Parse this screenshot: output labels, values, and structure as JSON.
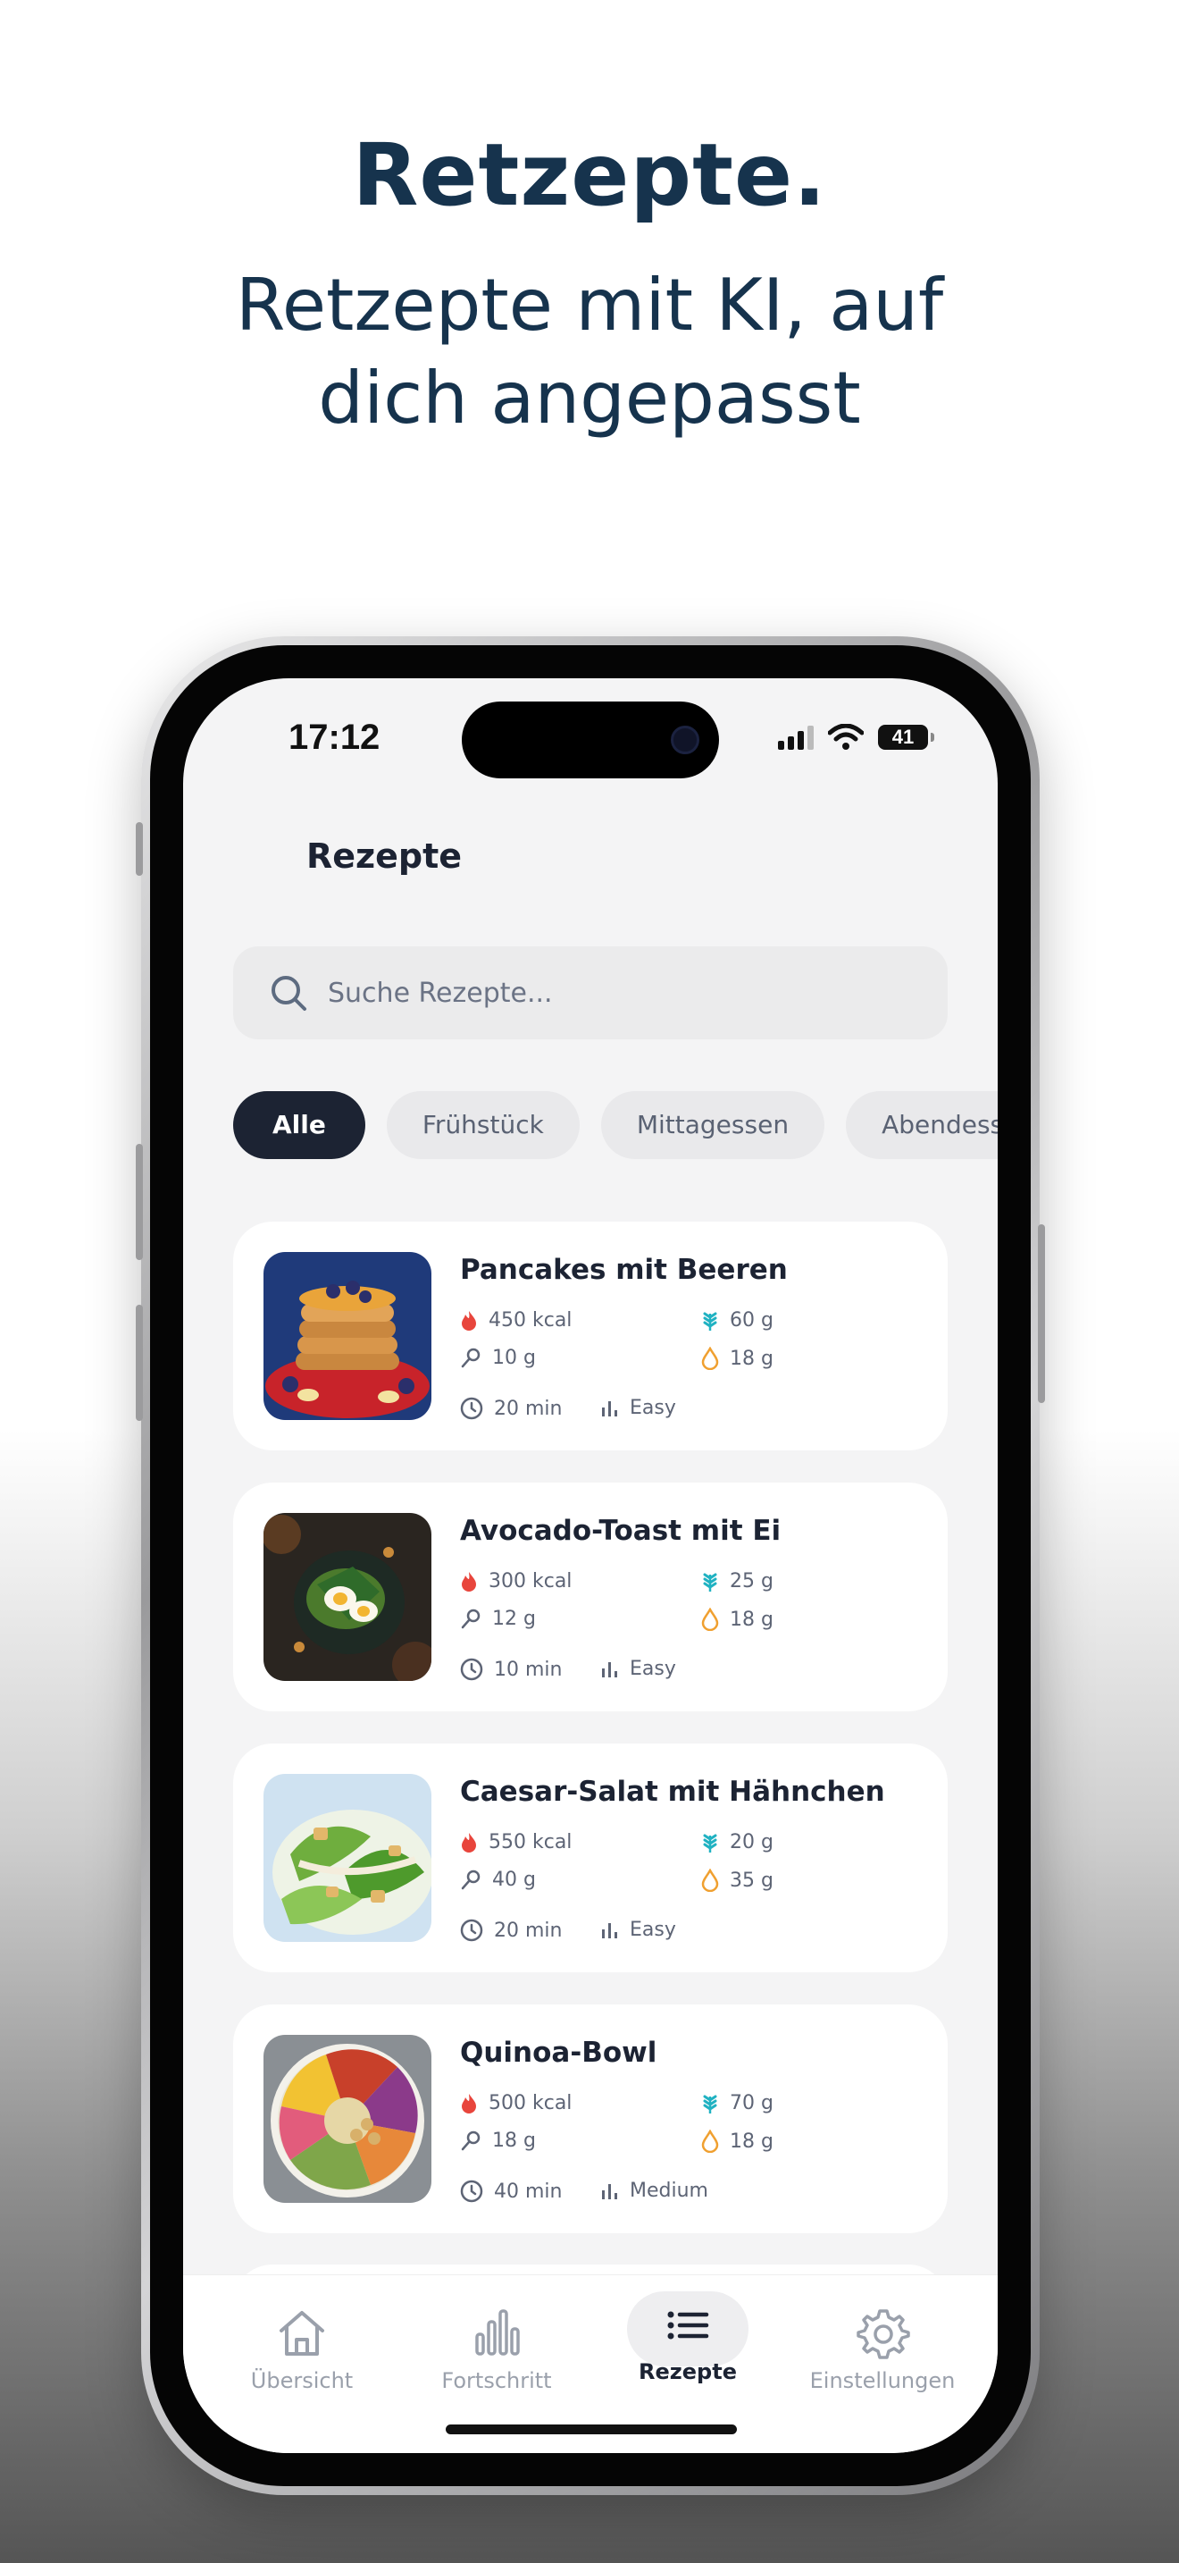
{
  "hero": {
    "title": "Retzepte.",
    "subtitle_line1": "Retzepte mit KI, auf",
    "subtitle_line2": "dich angepasst"
  },
  "status_bar": {
    "time": "17:12",
    "battery": "41"
  },
  "screen": {
    "title": "Rezepte",
    "search": {
      "placeholder": "Suche Rezepte..."
    },
    "filters": [
      {
        "label": "Alle",
        "selected": true
      },
      {
        "label": "Frühstück",
        "selected": false
      },
      {
        "label": "Mittagessen",
        "selected": false
      },
      {
        "label": "Abendessen",
        "selected": false
      }
    ],
    "recipes": [
      {
        "name": "Pancakes mit Beeren",
        "kcal": "450 kcal",
        "carbs": "60 g",
        "protein": "10 g",
        "fat": "18 g",
        "time": "20 min",
        "difficulty": "Easy"
      },
      {
        "name": "Avocado-Toast mit Ei",
        "kcal": "300 kcal",
        "carbs": "25 g",
        "protein": "12 g",
        "fat": "18 g",
        "time": "10 min",
        "difficulty": "Easy"
      },
      {
        "name": "Caesar-Salat mit Hähnchen",
        "kcal": "550 kcal",
        "carbs": "20 g",
        "protein": "40 g",
        "fat": "35 g",
        "time": "20 min",
        "difficulty": "Easy"
      },
      {
        "name": "Quinoa-Bowl",
        "kcal": "500 kcal",
        "carbs": "70 g",
        "protein": "18 g",
        "fat": "18 g",
        "time": "40 min",
        "difficulty": "Medium"
      }
    ]
  },
  "tabbar": {
    "items": [
      {
        "label": "Übersicht",
        "icon": "home-icon"
      },
      {
        "label": "Fortschritt",
        "icon": "bar-chart-icon"
      },
      {
        "label": "Rezepte",
        "icon": "list-icon",
        "active": true
      },
      {
        "label": "Einstellungen",
        "icon": "gear-icon"
      }
    ]
  },
  "colors": {
    "brand_dark": "#16334d",
    "chip_active": "#1c2333",
    "calorie_icon": "#e8453c",
    "carbs_icon": "#20b2c2",
    "fat_icon": "#f0a030"
  }
}
